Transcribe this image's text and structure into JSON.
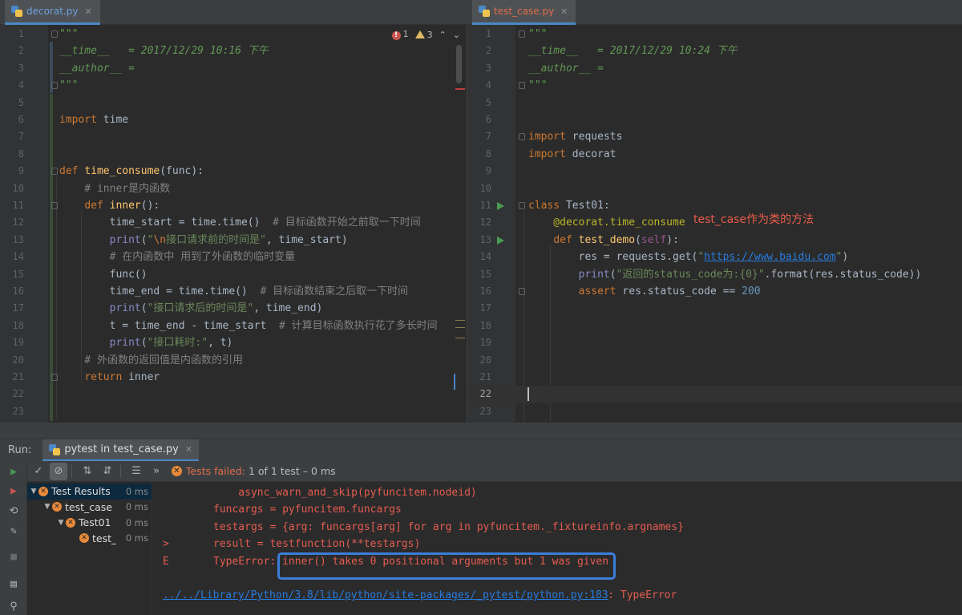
{
  "left_editor": {
    "tab_label": "decorat.py",
    "inspection": {
      "errors": "1",
      "warnings": "3"
    },
    "lines": [
      {
        "n": "1",
        "tokens": [
          {
            "t": "\"\"\"",
            "c": "doc"
          }
        ]
      },
      {
        "n": "2",
        "tokens": [
          {
            "t": "__time__   = 2017/12/29 10:16 下午",
            "c": "doc"
          }
        ]
      },
      {
        "n": "3",
        "tokens": [
          {
            "t": "__author__ =",
            "c": "doc"
          }
        ]
      },
      {
        "n": "4",
        "tokens": [
          {
            "t": "\"\"\"",
            "c": "doc"
          }
        ]
      },
      {
        "n": "5",
        "tokens": []
      },
      {
        "n": "6",
        "tokens": [
          {
            "t": "import",
            "c": "kw"
          },
          {
            "t": " time",
            "c": "p"
          }
        ]
      },
      {
        "n": "7",
        "tokens": []
      },
      {
        "n": "8",
        "tokens": []
      },
      {
        "n": "9",
        "tokens": [
          {
            "t": "def",
            "c": "kw"
          },
          {
            "t": " ",
            "c": "p"
          },
          {
            "t": "time_consume",
            "c": "fn"
          },
          {
            "t": "(func):",
            "c": "p"
          }
        ]
      },
      {
        "n": "10",
        "tokens": [
          {
            "t": "    # inner是内函数",
            "c": "cmt"
          }
        ]
      },
      {
        "n": "11",
        "tokens": [
          {
            "t": "    ",
            "c": "p"
          },
          {
            "t": "def",
            "c": "kw"
          },
          {
            "t": " ",
            "c": "p"
          },
          {
            "t": "inner",
            "c": "fn"
          },
          {
            "t": "():",
            "c": "p"
          }
        ]
      },
      {
        "n": "12",
        "tokens": [
          {
            "t": "        time_start = time.time()  ",
            "c": "p"
          },
          {
            "t": "# 目标函数开始之前取一下时间",
            "c": "cmt"
          }
        ]
      },
      {
        "n": "13",
        "tokens": [
          {
            "t": "        ",
            "c": "p"
          },
          {
            "t": "print",
            "c": "builtin"
          },
          {
            "t": "(",
            "c": "p"
          },
          {
            "t": "\"",
            "c": "str"
          },
          {
            "t": "\\n",
            "c": "esc"
          },
          {
            "t": "接口请求前的时间是\"",
            "c": "str"
          },
          {
            "t": ", time_start)",
            "c": "p"
          }
        ]
      },
      {
        "n": "14",
        "tokens": [
          {
            "t": "        # 在内函数中 用到了外函数的临时变量",
            "c": "cmt"
          }
        ]
      },
      {
        "n": "15",
        "tokens": [
          {
            "t": "        func()",
            "c": "p"
          }
        ]
      },
      {
        "n": "16",
        "tokens": [
          {
            "t": "        time_end = time.time()  ",
            "c": "p"
          },
          {
            "t": "# 目标函数结束之后取一下时间",
            "c": "cmt"
          }
        ]
      },
      {
        "n": "17",
        "tokens": [
          {
            "t": "        ",
            "c": "p"
          },
          {
            "t": "print",
            "c": "builtin"
          },
          {
            "t": "(",
            "c": "p"
          },
          {
            "t": "\"接口请求后的时间是\"",
            "c": "str"
          },
          {
            "t": ", time_end)",
            "c": "p"
          }
        ]
      },
      {
        "n": "18",
        "tokens": [
          {
            "t": "        t = time_end - time_start  ",
            "c": "p"
          },
          {
            "t": "# 计算目标函数执行花了多长时间",
            "c": "cmt"
          }
        ]
      },
      {
        "n": "19",
        "tokens": [
          {
            "t": "        ",
            "c": "p"
          },
          {
            "t": "print",
            "c": "builtin"
          },
          {
            "t": "(",
            "c": "p"
          },
          {
            "t": "\"接口耗时:\"",
            "c": "str"
          },
          {
            "t": ", t)",
            "c": "p"
          }
        ]
      },
      {
        "n": "20",
        "tokens": [
          {
            "t": "    # 外函数的返回值是内函数的引用",
            "c": "cmt"
          }
        ]
      },
      {
        "n": "21",
        "tokens": [
          {
            "t": "    ",
            "c": "p"
          },
          {
            "t": "return",
            "c": "kw"
          },
          {
            "t": " inner",
            "c": "p"
          }
        ]
      },
      {
        "n": "22",
        "tokens": []
      },
      {
        "n": "23",
        "tokens": []
      }
    ]
  },
  "right_editor": {
    "tab_label": "test_case.py",
    "annotation": "test_case作为类的方法",
    "lines": [
      {
        "n": "1",
        "tokens": [
          {
            "t": "\"\"\"",
            "c": "doc"
          }
        ]
      },
      {
        "n": "2",
        "tokens": [
          {
            "t": "__time__   = 2017/12/29 10:24 下午",
            "c": "doc"
          }
        ]
      },
      {
        "n": "3",
        "tokens": [
          {
            "t": "__author__ =",
            "c": "doc"
          }
        ]
      },
      {
        "n": "4",
        "tokens": [
          {
            "t": "\"\"\"",
            "c": "doc"
          }
        ]
      },
      {
        "n": "5",
        "tokens": []
      },
      {
        "n": "6",
        "tokens": []
      },
      {
        "n": "7",
        "tokens": [
          {
            "t": "import",
            "c": "kw"
          },
          {
            "t": " requests",
            "c": "p"
          }
        ]
      },
      {
        "n": "8",
        "tokens": [
          {
            "t": "import",
            "c": "kw"
          },
          {
            "t": " decorat",
            "c": "p"
          }
        ]
      },
      {
        "n": "9",
        "tokens": []
      },
      {
        "n": "10",
        "tokens": []
      },
      {
        "n": "11",
        "tokens": [
          {
            "t": "class",
            "c": "kw"
          },
          {
            "t": " Test01:",
            "c": "p"
          }
        ],
        "run": true
      },
      {
        "n": "12",
        "tokens": [
          {
            "t": "    @decorat.time_consume",
            "c": "deco"
          }
        ]
      },
      {
        "n": "13",
        "tokens": [
          {
            "t": "    ",
            "c": "p"
          },
          {
            "t": "def",
            "c": "kw"
          },
          {
            "t": " ",
            "c": "p"
          },
          {
            "t": "test_demo",
            "c": "fn"
          },
          {
            "t": "(",
            "c": "p"
          },
          {
            "t": "self",
            "c": "self"
          },
          {
            "t": "):",
            "c": "p"
          }
        ],
        "run": true
      },
      {
        "n": "14",
        "tokens": [
          {
            "t": "        res = requests.get(",
            "c": "p"
          },
          {
            "t": "\"",
            "c": "str"
          },
          {
            "t": "https://www.baidu.com",
            "c": "url"
          },
          {
            "t": "\"",
            "c": "str"
          },
          {
            "t": ")",
            "c": "p"
          }
        ]
      },
      {
        "n": "15",
        "tokens": [
          {
            "t": "        ",
            "c": "p"
          },
          {
            "t": "print",
            "c": "builtin"
          },
          {
            "t": "(",
            "c": "p"
          },
          {
            "t": "\"返回的status_code为:{0}\"",
            "c": "str"
          },
          {
            "t": ".format(res.status_code))",
            "c": "p"
          }
        ]
      },
      {
        "n": "16",
        "tokens": [
          {
            "t": "        ",
            "c": "p"
          },
          {
            "t": "assert",
            "c": "kw"
          },
          {
            "t": " res.status_code == ",
            "c": "p"
          },
          {
            "t": "200",
            "c": "num"
          }
        ]
      },
      {
        "n": "17",
        "tokens": []
      },
      {
        "n": "18",
        "tokens": []
      },
      {
        "n": "19",
        "tokens": []
      },
      {
        "n": "20",
        "tokens": []
      },
      {
        "n": "21",
        "tokens": []
      },
      {
        "n": "22",
        "tokens": [],
        "current": true
      },
      {
        "n": "23",
        "tokens": []
      }
    ]
  },
  "run_panel": {
    "label": "Run:",
    "tab_label": "pytest in test_case.py",
    "status_failed": "Tests failed:",
    "status_detail": "1 of 1 test – 0 ms",
    "tree": [
      {
        "name": "Test Results",
        "time": "0 ms",
        "indent": 0,
        "arrow": "▼",
        "selected": true
      },
      {
        "name": "test_case",
        "time": "0 ms",
        "indent": 1,
        "arrow": "▼"
      },
      {
        "name": "Test01",
        "time": "0 ms",
        "indent": 2,
        "arrow": "▼"
      },
      {
        "name": "test_",
        "time": "0 ms",
        "indent": 3,
        "arrow": ""
      }
    ],
    "console": [
      {
        "prefix": "",
        "text": "    async_warn_and_skip(pyfuncitem.nodeid)"
      },
      {
        "prefix": "",
        "text": "funcargs = pyfuncitem.funcargs"
      },
      {
        "prefix": "",
        "text": "testargs = {arg: funcargs[arg] for arg in pyfuncitem._fixtureinfo.argnames}"
      },
      {
        "prefix": ">",
        "text": "result = testfunction(**testargs)"
      },
      {
        "prefix": "E",
        "text": "TypeError: inner() takes 0 positional arguments but 1 was given"
      },
      {
        "prefix": "",
        "text": ""
      }
    ],
    "link": "../../Library/Python/3.8/lib/python/site-packages/_pytest/python.py:183",
    "link_suffix": ": TypeError"
  },
  "colors": {
    "background": "#2b2b2b",
    "keyword": "#cc7832",
    "function": "#ffc66d",
    "string": "#6a8759",
    "error_text": "#e55c50",
    "highlight_border": "#3b7ed9",
    "annotation": "#e85c4a"
  },
  "icons": {
    "tab_file": "python-file-icon",
    "run": "run-triangle-icon",
    "test_failed": "test-failed-icon",
    "inspection_error": "error-icon",
    "inspection_warning": "warning-icon"
  }
}
